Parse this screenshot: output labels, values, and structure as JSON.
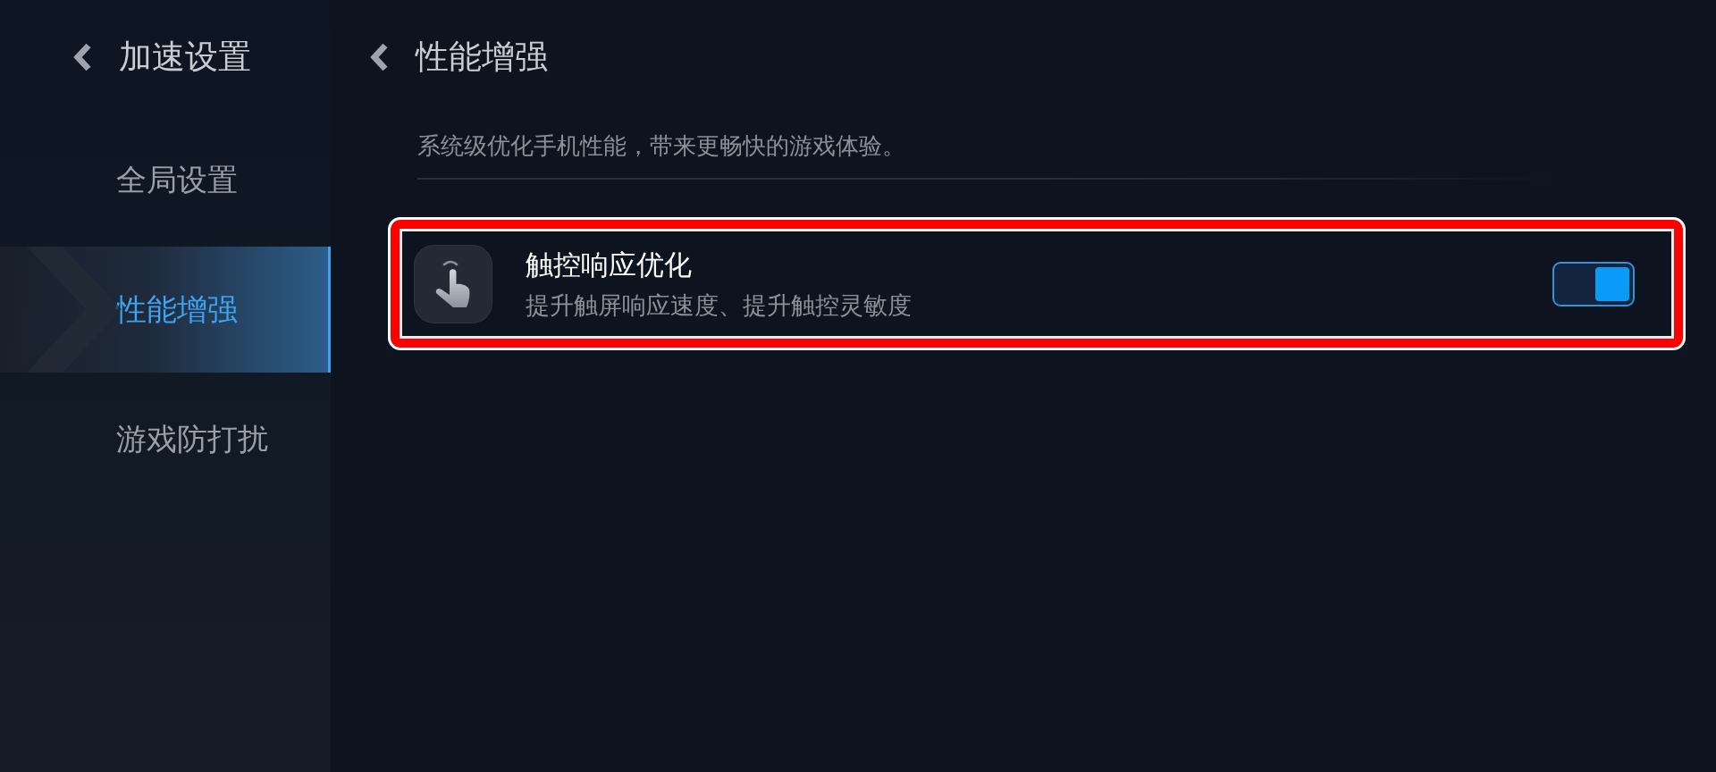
{
  "sidebar": {
    "back_label": "加速设置",
    "items": [
      {
        "label": "全局设置",
        "selected": false
      },
      {
        "label": "性能增强",
        "selected": true
      },
      {
        "label": "游戏防打扰",
        "selected": false
      }
    ]
  },
  "page": {
    "title": "性能增强",
    "description": "系统级优化手机性能，带来更畅快的游戏体验。"
  },
  "settings": [
    {
      "title": "触控响应优化",
      "subtitle": "提升触屏响应速度、提升触控灵敏度",
      "on": true,
      "highlighted": true
    }
  ]
}
